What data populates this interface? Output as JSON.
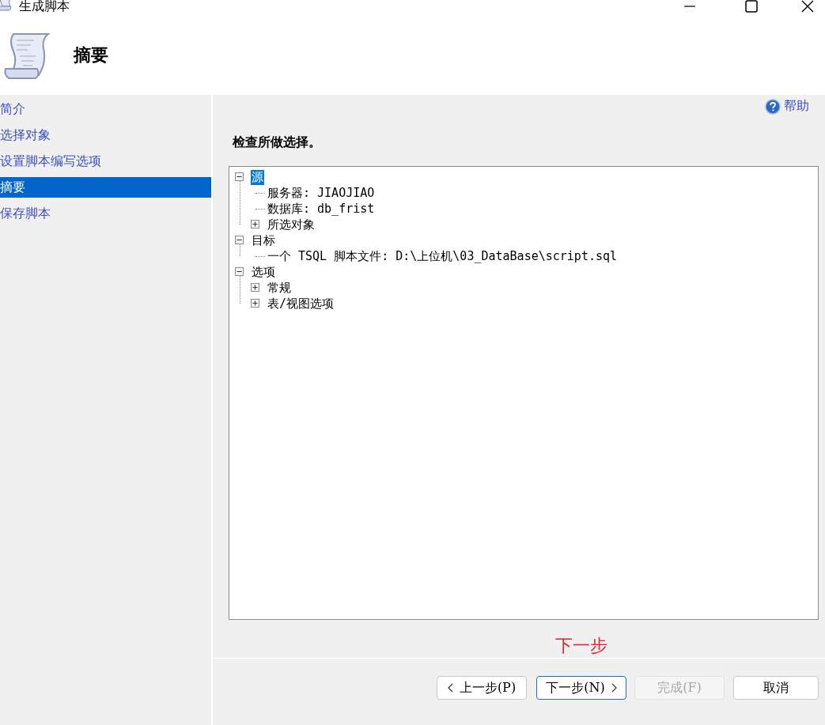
{
  "window": {
    "title": "生成脚本"
  },
  "header": {
    "title": "摘要"
  },
  "sidebar": {
    "items": [
      {
        "label": "简介",
        "selected": false
      },
      {
        "label": "选择对象",
        "selected": false
      },
      {
        "label": "设置脚本编写选项",
        "selected": false
      },
      {
        "label": "摘要",
        "selected": true
      },
      {
        "label": "保存脚本",
        "selected": false
      }
    ]
  },
  "help_link": "帮助",
  "instruction": "检查所做选择。",
  "tree": [
    {
      "label": "源",
      "expanded": true,
      "selected": true,
      "children": [
        {
          "label": "服务器: JIAOJIAO",
          "selected": false
        },
        {
          "label": "数据库: db_frist",
          "selected": false
        },
        {
          "label": "所选对象",
          "expanded": false,
          "selected": false
        }
      ]
    },
    {
      "label": "目标",
      "expanded": true,
      "selected": false,
      "children": [
        {
          "label": "一个 TSQL 脚本文件: D:\\上位机\\03_DataBase\\script.sql",
          "selected": false
        }
      ]
    },
    {
      "label": "选项",
      "expanded": true,
      "selected": false,
      "children": [
        {
          "label": "常规",
          "expanded": false,
          "selected": false
        },
        {
          "label": "表/视图选项",
          "expanded": false,
          "selected": false
        }
      ]
    }
  ],
  "annotation": "下一步",
  "buttons": [
    {
      "label": "上一步(P)",
      "kind": "back",
      "disabled": false,
      "focused": false
    },
    {
      "label": "下一步(N)",
      "kind": "next",
      "disabled": false,
      "focused": true
    },
    {
      "label": "完成(F)",
      "kind": "plain",
      "disabled": true,
      "focused": false
    },
    {
      "label": "取消",
      "kind": "plain",
      "disabled": false,
      "focused": false
    }
  ]
}
